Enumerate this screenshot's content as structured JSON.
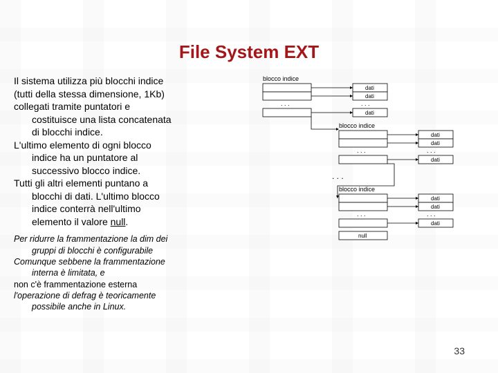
{
  "title": "File System EXT",
  "body": {
    "l1": "Il sistema utilizza più blocchi indice",
    "l2": "(tutti della stessa dimensione, 1Kb)",
    "l3": "collegati tramite puntatori e",
    "l4": "costituisce una lista concatenata",
    "l5": "di blocchi indice.",
    "l6": "L'ultimo elemento di ogni blocco",
    "l7": "indice ha un puntatore al",
    "l8": "successivo blocco indice.",
    "l9": "Tutti gli altri elementi puntano a",
    "l10": "blocchi di dati. L'ultimo blocco",
    "l11": "indice conterrà nell'ultimo",
    "l12a": "elemento il valore ",
    "l12b": "null",
    "l12c": "."
  },
  "foot": {
    "l1": "Per ridurre la frammentazione la dim dei",
    "l2": "gruppi di blocchi è configurabile",
    "l3": "Comunque sebbene la frammentazione",
    "l4": "interna è limitata, e",
    "l5": "non c'è frammentazione esterna",
    "l6": "l'operazione di defrag è teoricamente",
    "l7": "possibile anche in Linux."
  },
  "diagram": {
    "indexLabel": "blocco indice",
    "dataLabel": "dati",
    "nullLabel": "null",
    "dots": ". . ."
  },
  "pageNumber": "33"
}
